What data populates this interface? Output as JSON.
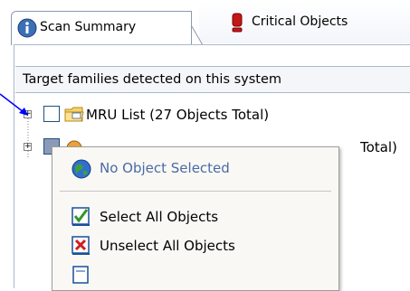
{
  "tabs": [
    {
      "label": "Scan Summary",
      "icon": "info-icon",
      "active": true
    },
    {
      "label": "Critical Objects",
      "icon": "exclamation-icon",
      "active": false
    }
  ],
  "panel": {
    "header": "Target families detected on this system"
  },
  "tree": [
    {
      "label": "MRU List (27 Objects Total)",
      "icon": "folder-icon",
      "checked": false
    },
    {
      "label": "Total)",
      "icon": "cookie-icon",
      "checked": false
    }
  ],
  "context_menu": {
    "header": "No Object Selected",
    "items": [
      {
        "label": "Select All Objects",
        "icon": "checkbox-checked-icon"
      },
      {
        "label": "Unselect All Objects",
        "icon": "checkbox-x-icon"
      }
    ]
  },
  "colors": {
    "accent_blue": "#3b6fb6",
    "menu_disabled_text": "#4a6aa5",
    "annotation_arrow": "#0000ff"
  }
}
